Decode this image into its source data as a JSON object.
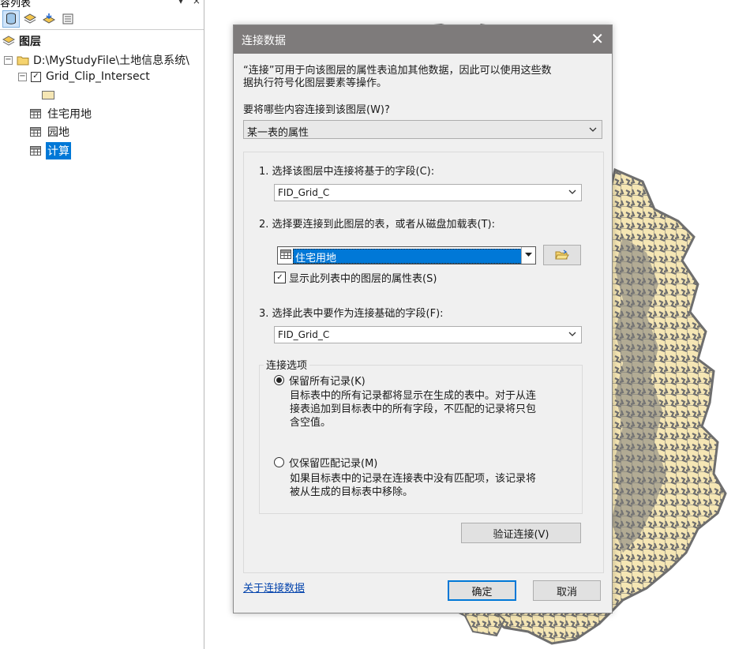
{
  "toc": {
    "title": "容列表",
    "pin": "▾ ×",
    "layers_label": "图层",
    "folder_path": "D:\\MyStudyFile\\土地信息系统\\",
    "layer_name": "Grid_Clip_Intersect",
    "layer_checked": "✓",
    "tables": [
      "住宅用地",
      "园地",
      "计算"
    ]
  },
  "dialog": {
    "title": "连接数据",
    "close_glyph": "✕",
    "description": [
      "“连接”可用于向该图层的属性表追加其他数据，因此可以使用这些数",
      "据执行符号化图层要素等操作。"
    ],
    "question": "要将哪些内容连接到该图层(W)?",
    "join_type": "某一表的属性",
    "step1_label": "1. 选择该图层中连接将基于的字段(C):",
    "step1_value": "FID_Grid_C",
    "step2_label": "2. 选择要连接到此图层的表，或者从磁盘加载表(T):",
    "step2_value": "住宅用地",
    "show_layers_checkbox": "显示此列表中的图层的属性表(S)",
    "show_layers_checked": "✓",
    "step3_label": "3. 选择此表中要作为连接基础的字段(F):",
    "step3_value": "FID_Grid_C",
    "options_title": "连接选项",
    "keep_all_label": "保留所有记录(K)",
    "keep_all_desc": [
      "目标表中的所有记录都将显示在生成的表中。对于从连",
      "接表追加到目标表中的所有字段，不匹配的记录将只包",
      "含空值。"
    ],
    "keep_matching_label": "仅保留匹配记录(M)",
    "keep_matching_desc": [
      "如果目标表中的记录在连接表中没有匹配项，该记录将",
      "被从生成的目标表中移除。"
    ],
    "validate_button": "验证连接(V)",
    "about_link": "关于连接数据",
    "ok_button": "确定",
    "cancel_button": "取消"
  },
  "colors": {
    "titlebar": "#7e7b7b",
    "selection": "#0078d7",
    "polygon_fill": "#f5e6b4",
    "polygon_outline": "#6e6e6e"
  }
}
